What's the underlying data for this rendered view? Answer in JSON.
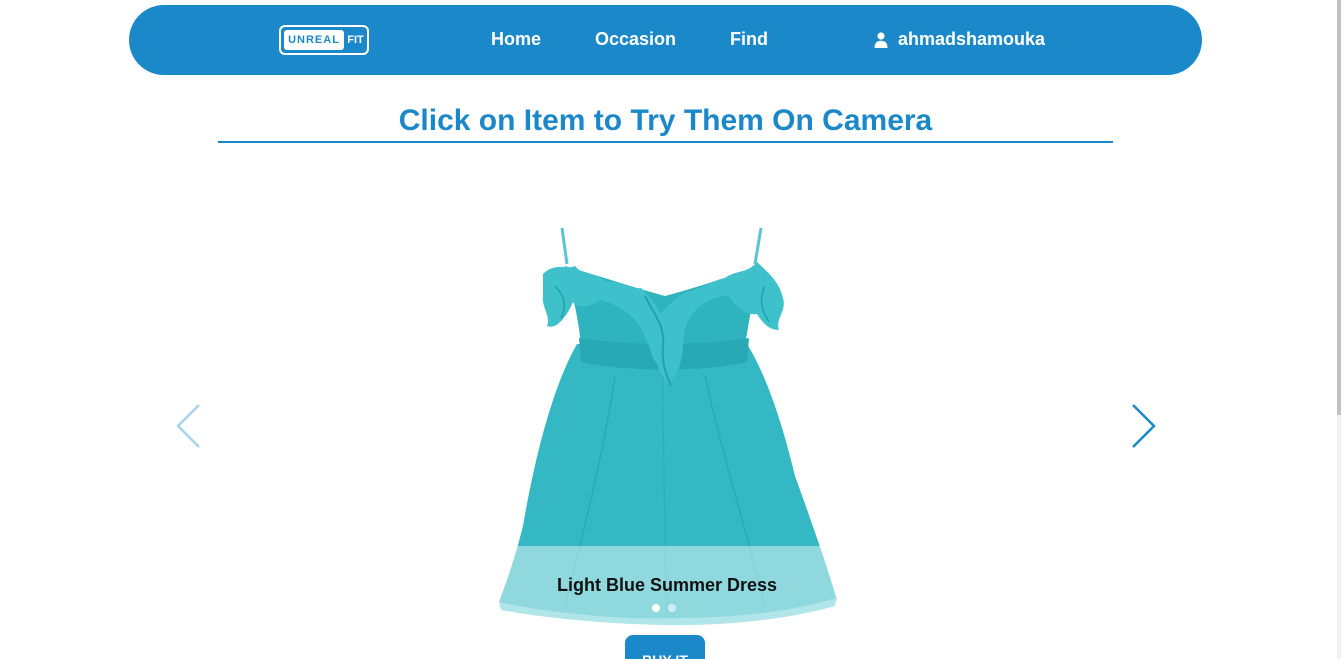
{
  "navbar": {
    "logo": {
      "part1": "UNREAL",
      "part2": "FIT"
    },
    "links": {
      "home": "Home",
      "occasion": "Occasion",
      "find": "Find"
    },
    "user": {
      "icon": "user-icon",
      "name": "ahmadshamouka"
    }
  },
  "main": {
    "title": "Click on Item to Try Them On Camera"
  },
  "carousel": {
    "caption": "Light Blue Summer Dress",
    "slides_count": 2,
    "active_slide": 1,
    "prev_icon": "chevron-left-icon",
    "next_icon": "chevron-right-icon",
    "buy_label": "BUY IT"
  },
  "colors": {
    "primary": "#1a88c9",
    "dress": "#33b8c4",
    "dress_shadow": "#21a2ae",
    "background": "#ffffff"
  }
}
